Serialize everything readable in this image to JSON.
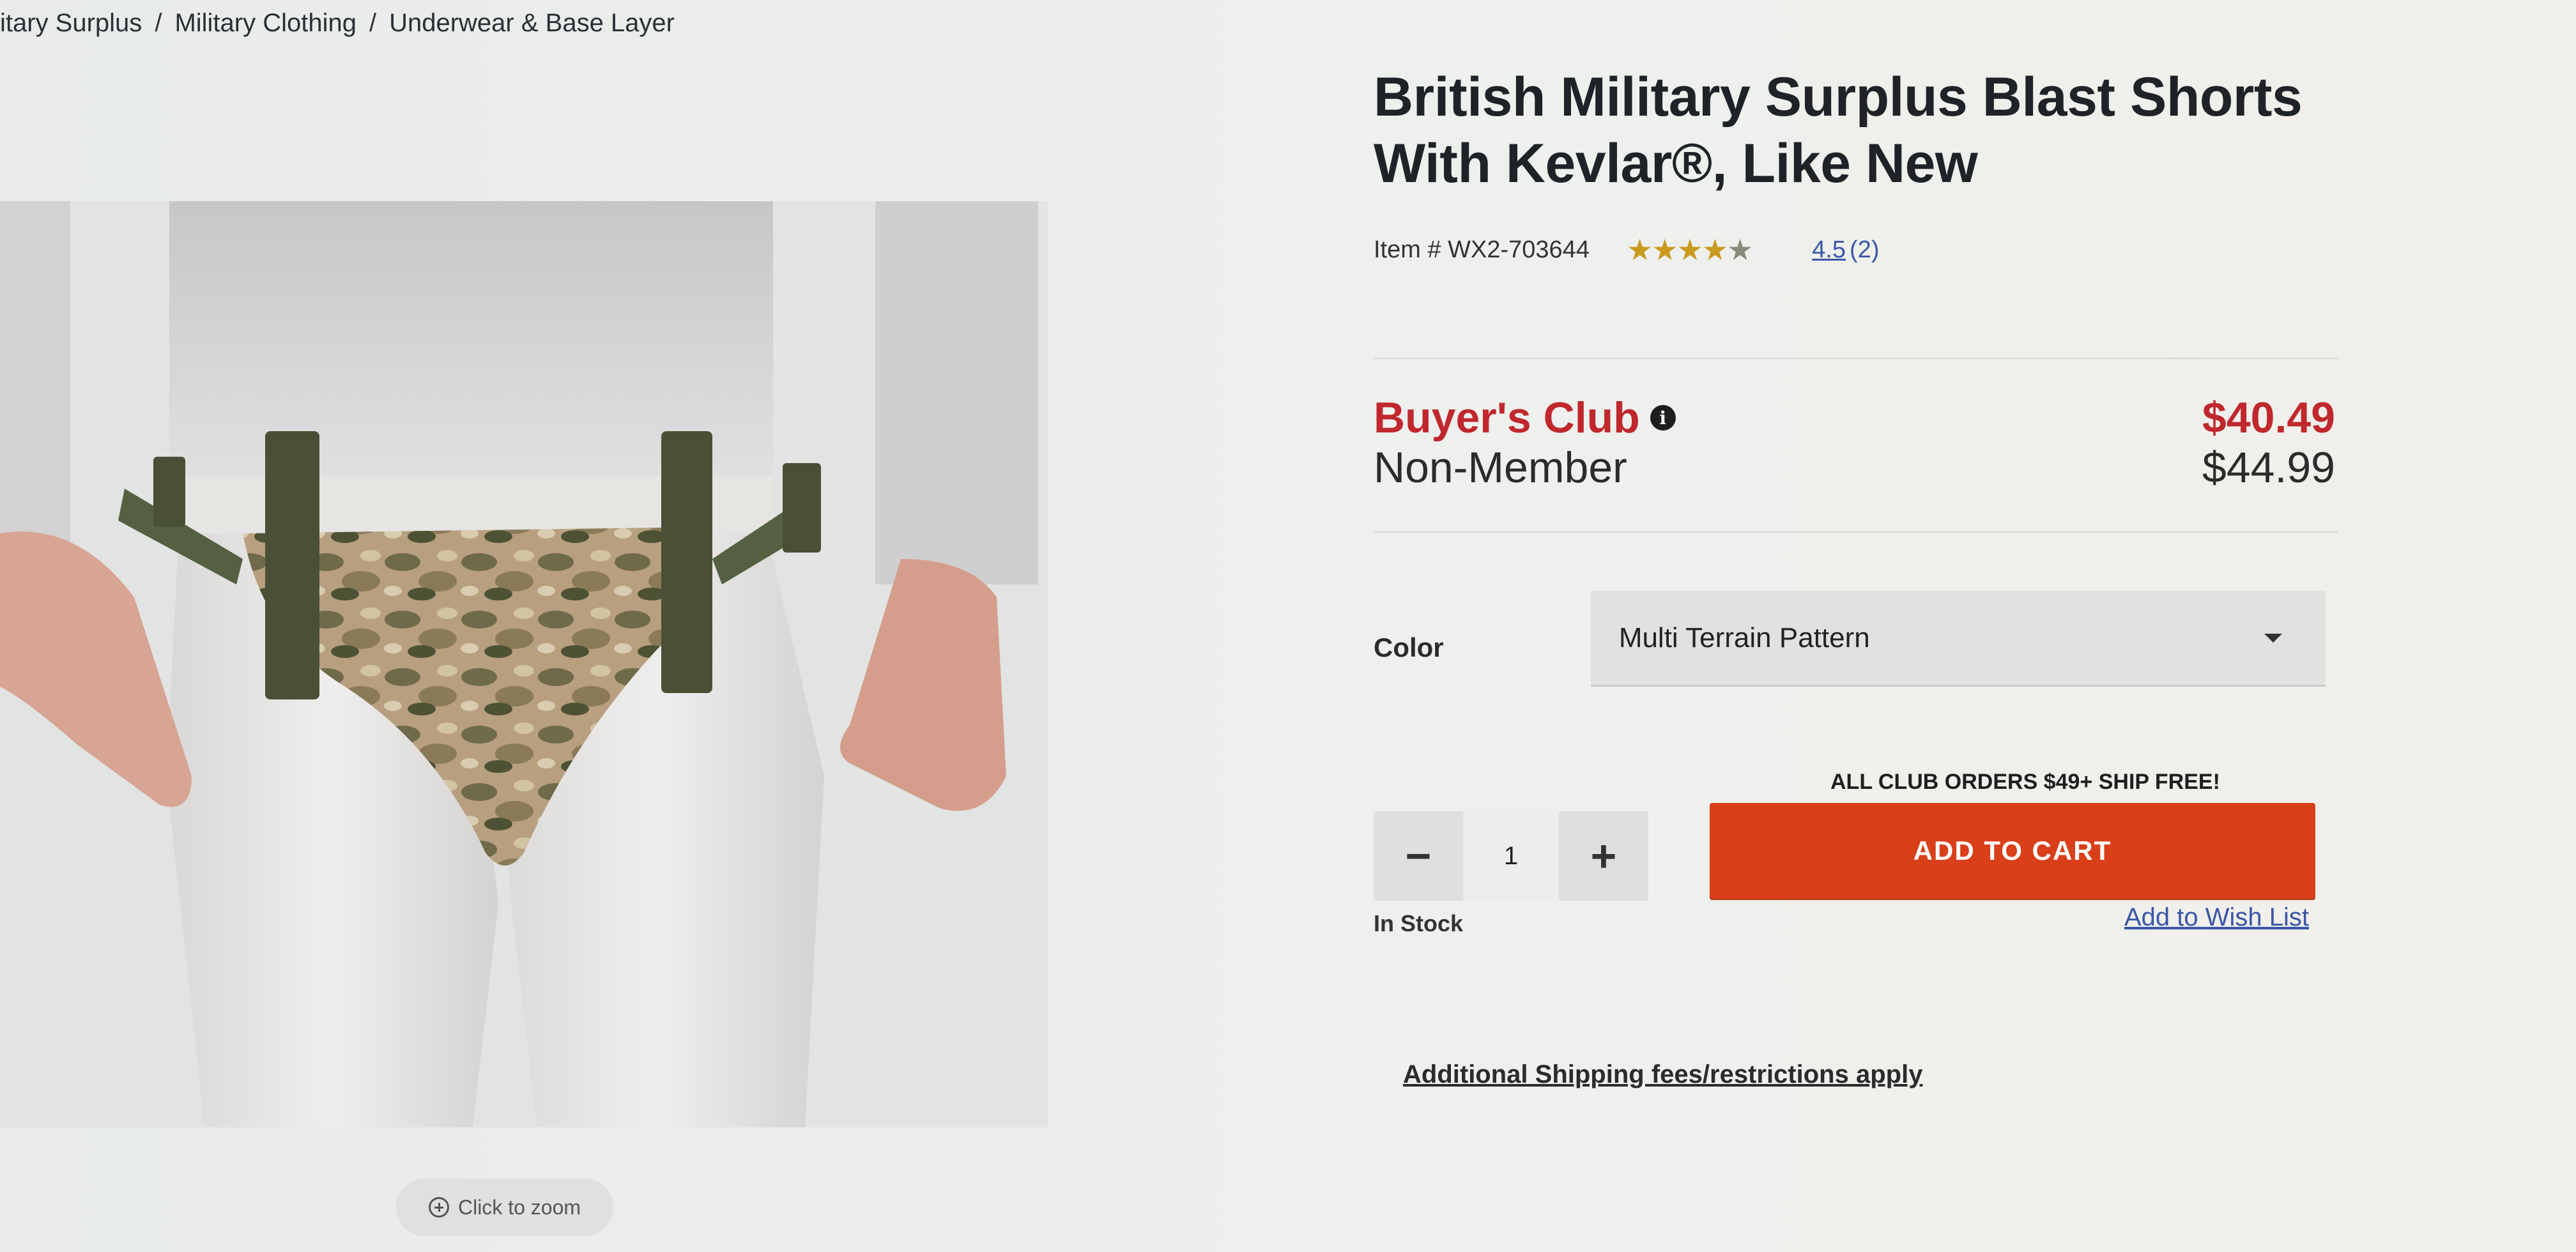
{
  "breadcrumb": {
    "items": [
      "itary Surplus",
      "Military Clothing",
      "Underwear & Base Layer"
    ],
    "separator": "/"
  },
  "product": {
    "title_line1": "British Military Surplus Blast Shorts",
    "title_line2": "With Kevlar®, Like New",
    "item_number": "Item # WX2-703644",
    "rating": "4.5",
    "review_count": "(2)",
    "stars_icon": "star-rating-icon"
  },
  "pricing": {
    "club_label": "Buyer's Club",
    "club_price": "$40.49",
    "nonmember_label": "Non-Member",
    "nonmember_price": "$44.99",
    "club_color": "#c0282d"
  },
  "options": {
    "color_label": "Color",
    "color_value": "Multi Terrain Pattern"
  },
  "purchase": {
    "ship_note": "ALL CLUB ORDERS $49+ SHIP FREE!",
    "minus": "−",
    "quantity": "1",
    "plus": "+",
    "add_to_cart": "ADD TO CART",
    "cart_color": "#d9401a",
    "stock_status": "In Stock",
    "wishlist": "Add to Wish List",
    "shipping_link": "Additional Shipping fees/restrictions apply"
  },
  "gallery": {
    "zoom_label": "Click to zoom"
  }
}
